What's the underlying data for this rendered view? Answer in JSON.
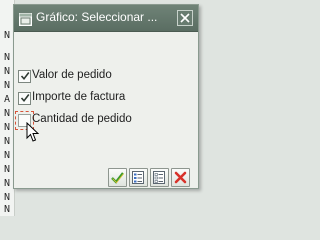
{
  "background": {
    "side_chars": [
      "N",
      "N",
      "N",
      "N",
      "A",
      "N",
      "N",
      "N",
      "N",
      "N",
      "N",
      "N",
      "N"
    ]
  },
  "dialog": {
    "title": "Gráfico: Seleccionar ...",
    "options": [
      {
        "label": "Valor de pedido",
        "checked": true
      },
      {
        "label": "Importe de factura",
        "checked": true
      },
      {
        "label": "Cantidad de pedido",
        "checked": false
      }
    ],
    "toolbar": {
      "confirm_icon": "checkmark-icon",
      "select_all_icon": "select-all-icon",
      "deselect_all_icon": "deselect-all-icon",
      "cancel_icon": "cancel-x-icon"
    }
  },
  "colors": {
    "titlebar": "#5f7367",
    "confirm_green": "#3a9a2a",
    "cancel_red": "#d8322a"
  }
}
